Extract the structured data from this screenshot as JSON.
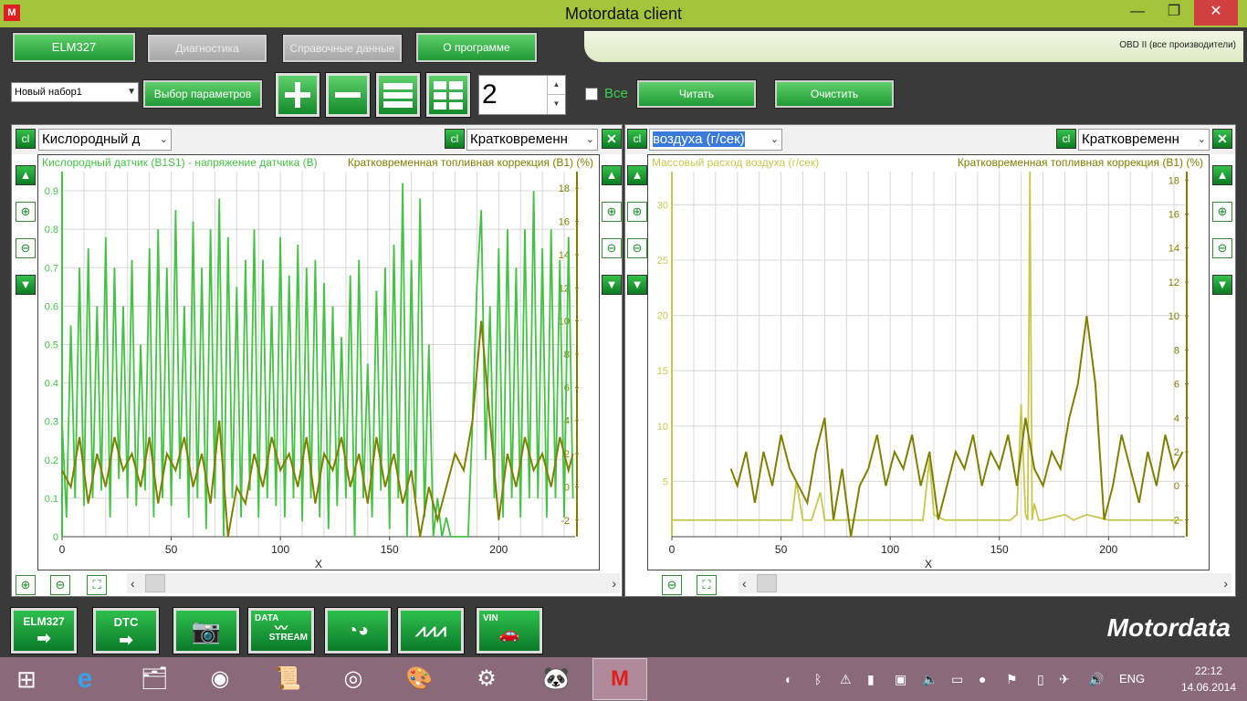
{
  "window": {
    "title": "Motordata client"
  },
  "menu": {
    "elm": "ELM327",
    "diag": "Диагностика",
    "ref": "Справочные данные",
    "about": "О программе",
    "obd": "OBD II (все производители)"
  },
  "toolbar": {
    "set": "Новый набор1",
    "choose": "Выбор параметров",
    "count": "2",
    "all": "Все",
    "read": "Читать",
    "clear": "Очистить"
  },
  "panel1": {
    "param1": "Кислородный д",
    "param2": "Кратковременн",
    "legend1": "Кислородный датчик (B1S1) - напряжение датчика  (В)",
    "legend2": "Кратковременная топливная коррекция (B1)   (%)"
  },
  "panel2": {
    "param1": "воздуха   (г/сек)",
    "param2": "Кратковременн",
    "legend1": "Массовый расход воздуха   (г/сек)",
    "legend2": "Кратковременная топливная коррекция (B1)   (%)"
  },
  "chart_data": [
    {
      "type": "line",
      "title": "",
      "xlabel": "X",
      "xlim": [
        0,
        235
      ],
      "x_ticks": [
        0,
        50,
        100,
        150,
        200
      ],
      "yleft": {
        "lim": [
          0,
          0.95
        ],
        "ticks": [
          0,
          0.1,
          0.2,
          0.3,
          0.4,
          0.5,
          0.6,
          0.7,
          0.8,
          0.9
        ],
        "color": "#45c245"
      },
      "yright": {
        "lim": [
          -3,
          19
        ],
        "ticks": [
          -2,
          0,
          2,
          4,
          6,
          8,
          10,
          12,
          14,
          16,
          18
        ],
        "color": "#7f7f00"
      },
      "series": [
        {
          "name": "Кислородный датчик (B1S1) - напряжение датчика  (В)",
          "axis": "left",
          "color": "#45c245",
          "x": [
            0,
            2,
            4,
            6,
            8,
            10,
            12,
            14,
            16,
            18,
            20,
            22,
            24,
            26,
            28,
            30,
            32,
            34,
            36,
            38,
            40,
            42,
            44,
            46,
            48,
            50,
            52,
            54,
            56,
            58,
            60,
            62,
            64,
            66,
            68,
            70,
            72,
            74,
            76,
            78,
            80,
            82,
            84,
            86,
            88,
            90,
            92,
            94,
            96,
            98,
            100,
            102,
            104,
            106,
            108,
            110,
            112,
            114,
            116,
            118,
            120,
            122,
            124,
            126,
            128,
            130,
            132,
            134,
            136,
            138,
            140,
            142,
            144,
            146,
            148,
            150,
            152,
            154,
            156,
            158,
            160,
            162,
            164,
            166,
            168,
            170,
            172,
            174,
            176,
            178,
            180,
            182,
            184,
            186,
            188,
            190,
            192,
            194,
            196,
            198,
            200,
            202,
            204,
            206,
            208,
            210,
            212,
            214,
            216,
            218,
            220,
            222,
            224,
            226,
            228,
            230,
            232,
            234
          ],
          "y": [
            0.3,
            0.05,
            0.55,
            0.1,
            0.7,
            0.08,
            0.75,
            0.1,
            0.6,
            0.12,
            0.78,
            0.05,
            0.7,
            0.15,
            0.6,
            0.1,
            0.72,
            0.08,
            0.5,
            0.12,
            0.75,
            0.05,
            0.8,
            0.1,
            0.7,
            0.08,
            0.85,
            0.15,
            0.6,
            0.05,
            0.82,
            0.1,
            0.7,
            0.02,
            0.8,
            0.1,
            0.88,
            0.0,
            0.78,
            0.1,
            0.65,
            0.05,
            0.72,
            0.12,
            0.8,
            0.05,
            0.72,
            0.1,
            0.6,
            0.08,
            0.78,
            0.05,
            0.68,
            0.1,
            0.76,
            0.04,
            0.7,
            0.1,
            0.72,
            0.05,
            0.66,
            0.02,
            0.6,
            0.08,
            0.52,
            0.1,
            0.68,
            0.0,
            0.72,
            0.1,
            0.45,
            0.05,
            0.64,
            0.12,
            0.7,
            0.02,
            0.76,
            0.1,
            0.92,
            0.0,
            0.72,
            0.1,
            0.88,
            0.05,
            0.5,
            0.0,
            0.1,
            0.0,
            0.05,
            0.0,
            0.0,
            0.0,
            0.0,
            0.0,
            0.3,
            0.65,
            0.85,
            0.2,
            0.6,
            0.1,
            0.75,
            0.05,
            0.8,
            0.1,
            0.7,
            0.05,
            0.8,
            0.1,
            0.9,
            0.1,
            0.75,
            0.05,
            0.8,
            0.1,
            0.72,
            0.05,
            0.78,
            0.1
          ]
        },
        {
          "name": "Кратковременная топливная коррекция (B1)   (%)",
          "axis": "right",
          "color": "#7f7f00",
          "x": [
            0,
            4,
            8,
            12,
            16,
            20,
            24,
            28,
            32,
            36,
            40,
            44,
            48,
            52,
            56,
            60,
            64,
            68,
            72,
            76,
            80,
            84,
            88,
            92,
            96,
            100,
            104,
            108,
            112,
            116,
            120,
            124,
            128,
            132,
            136,
            140,
            144,
            148,
            152,
            156,
            160,
            164,
            168,
            172,
            176,
            180,
            184,
            188,
            192,
            196,
            200,
            204,
            208,
            212,
            216,
            220,
            224,
            228,
            232,
            234
          ],
          "y": [
            1,
            0,
            3,
            -1,
            2,
            0,
            3,
            1,
            2,
            0,
            3,
            -1,
            2,
            1,
            3,
            0,
            2,
            -1,
            4,
            -3,
            0,
            -1,
            2,
            0,
            3,
            1,
            2,
            0,
            3,
            -1,
            2,
            1,
            3,
            0,
            2,
            -1,
            3,
            0,
            2,
            -1,
            1,
            -3,
            0,
            -2,
            0,
            2,
            1,
            4,
            10,
            4,
            -2,
            2,
            0,
            3,
            1,
            2,
            0,
            3,
            1,
            2
          ]
        }
      ]
    },
    {
      "type": "line",
      "title": "",
      "xlabel": "X",
      "xlim": [
        0,
        235
      ],
      "x_ticks": [
        0,
        50,
        100,
        150,
        200
      ],
      "yleft": {
        "lim": [
          0,
          33
        ],
        "ticks": [
          5,
          10,
          15,
          20,
          25,
          30
        ],
        "color": "#c8c850"
      },
      "yright": {
        "lim": [
          -3,
          18.5
        ],
        "ticks": [
          -2,
          0,
          2,
          4,
          6,
          8,
          10,
          12,
          14,
          16,
          18
        ],
        "color": "#7f7f00"
      },
      "series": [
        {
          "name": "Массовый расход воздуха   (г/сек)",
          "axis": "left",
          "color": "#c8c850",
          "x": [
            0,
            25,
            50,
            55,
            57,
            60,
            64,
            68,
            70,
            72,
            75,
            80,
            100,
            115,
            118,
            120,
            125,
            140,
            155,
            158,
            160,
            162,
            163,
            164,
            165,
            166,
            168,
            170,
            180,
            184,
            190,
            200,
            220,
            234
          ],
          "y": [
            1.5,
            1.5,
            1.5,
            1.5,
            5,
            1.5,
            1.5,
            4,
            1.5,
            1.5,
            1.5,
            1.5,
            1.5,
            1.5,
            7,
            2,
            1.5,
            1.5,
            1.5,
            2,
            12,
            2,
            1.5,
            33,
            1.5,
            3,
            1.5,
            1.5,
            2,
            1.5,
            2,
            1.5,
            1.5,
            1.5
          ]
        },
        {
          "name": "Кратковременная топливная коррекция (B1)   (%)",
          "axis": "right",
          "color": "#7f7f00",
          "x": [
            27,
            30,
            34,
            38,
            42,
            46,
            50,
            54,
            58,
            62,
            66,
            70,
            74,
            78,
            82,
            86,
            90,
            94,
            98,
            102,
            106,
            110,
            114,
            118,
            122,
            126,
            130,
            134,
            138,
            142,
            146,
            150,
            154,
            158,
            162,
            166,
            170,
            174,
            178,
            182,
            186,
            190,
            194,
            198,
            202,
            206,
            210,
            214,
            218,
            222,
            226,
            230,
            234
          ],
          "y": [
            1,
            0,
            2,
            -1,
            2,
            0,
            3,
            1,
            0,
            -1,
            2,
            4,
            -2,
            1,
            -3,
            0,
            1,
            3,
            0,
            2,
            1,
            3,
            0,
            2,
            -2,
            0,
            2,
            1,
            3,
            0,
            2,
            1,
            3,
            0,
            4,
            1,
            0,
            2,
            1,
            4,
            6,
            10,
            6,
            -2,
            0,
            3,
            1,
            -1,
            2,
            0,
            3,
            1,
            2
          ]
        }
      ]
    }
  ]
}
